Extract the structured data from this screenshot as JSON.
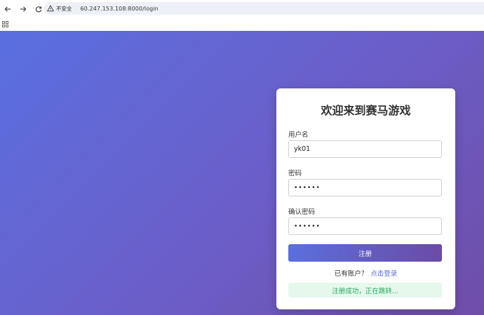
{
  "browser": {
    "security_label": "不安全",
    "url": "60.247.153.108:8000/login"
  },
  "form": {
    "title": "欢迎来到赛马游戏",
    "username_label": "用户名",
    "username_value": "yk01",
    "password_label": "密码",
    "password_value": "••••••",
    "confirm_label": "确认密码",
    "confirm_value": "••••••",
    "submit_label": "注册",
    "have_account_text": "已有账户？",
    "login_link": "点击登录",
    "success_message": "注册成功，正在跳转..."
  },
  "colors": {
    "gradient_start": "#5a6fe0",
    "gradient_end": "#6f4ea8",
    "link": "#5b6fdf",
    "success_text": "#23a85a",
    "success_bg": "#e6f7ec"
  },
  "icons": [
    "back-arrow-icon",
    "forward-arrow-icon",
    "reload-icon",
    "warning-icon",
    "apps-grid-icon"
  ]
}
